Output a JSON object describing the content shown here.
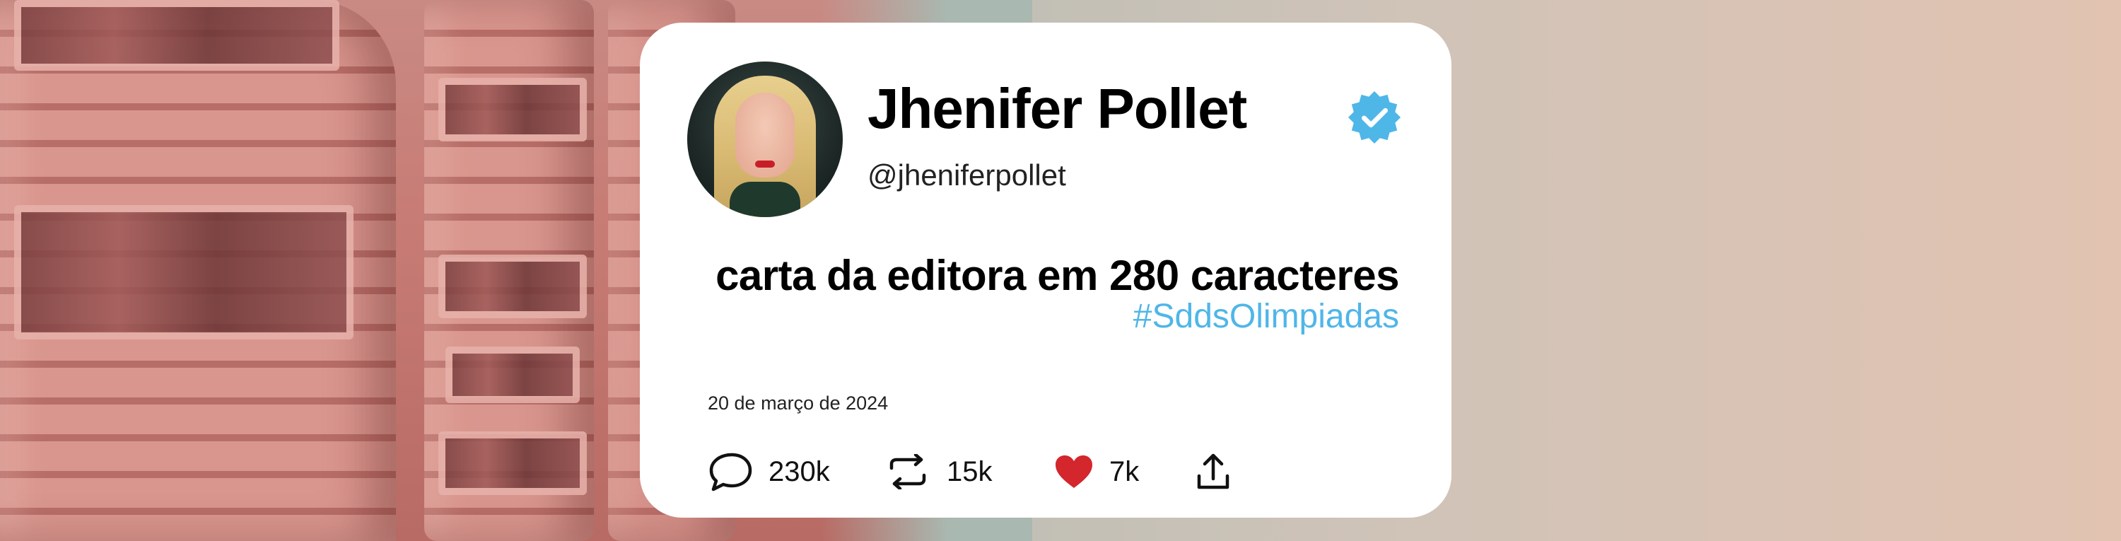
{
  "card": {
    "display_name": "Jhenifer Pollet",
    "handle": "@jheniferpollet",
    "text": "carta da editora em 280 caracteres",
    "hashtag": "#SddsOlimpiadas",
    "date": "20 de março de 2024"
  },
  "actions": {
    "replies": "230k",
    "retweets": "15k",
    "likes": "7k"
  },
  "icons": {
    "avatar": "profile-photo",
    "verified": "verified-badge-icon",
    "reply": "speech-bubble-icon",
    "retweet": "retweet-icon",
    "like": "heart-icon",
    "share": "share-upload-icon"
  },
  "colors": {
    "card_background": "#ffffff",
    "hashtag": "#4fb6e8",
    "verified_badge": "#4fb6e8",
    "like_heart": "#d3262d",
    "text": "#000000"
  }
}
